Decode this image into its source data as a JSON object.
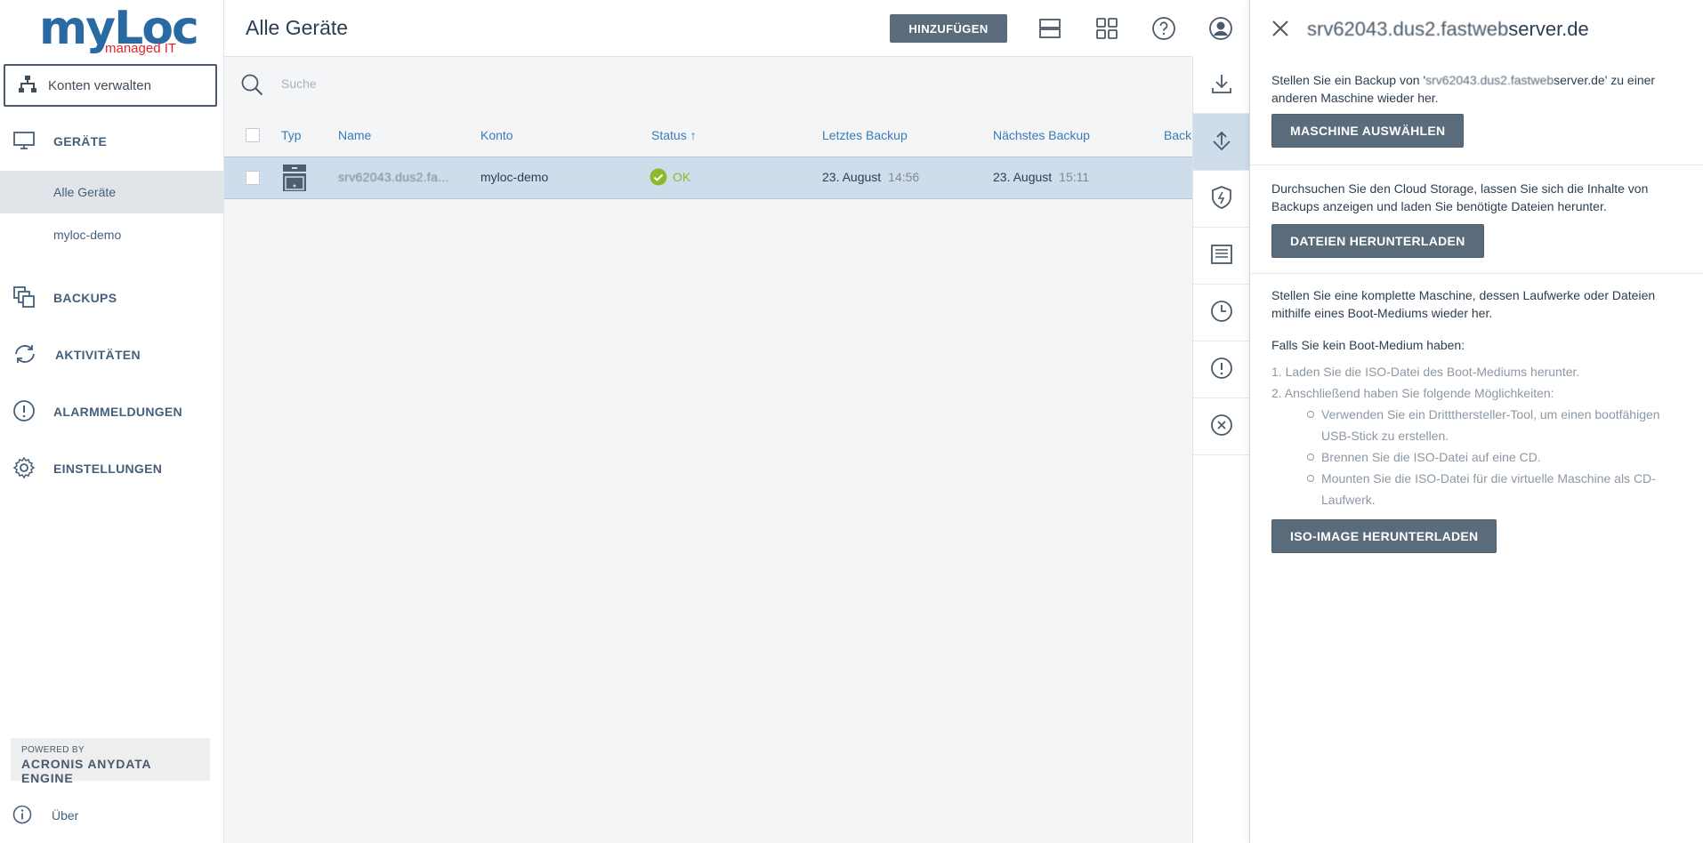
{
  "brand": {
    "name": "myLoc",
    "tagline": "managed IT",
    "primary": "#2a6aa3",
    "accent": "#e2232c"
  },
  "sidebar": {
    "konten_label": "Konten verwalten",
    "nav": [
      {
        "label": "GERÄTE",
        "icon": "monitor-icon"
      },
      {
        "label": "BACKUPS",
        "icon": "backups-icon"
      },
      {
        "label": "AKTIVITÄTEN",
        "icon": "sync-icon"
      },
      {
        "label": "ALARMMELDUNGEN",
        "icon": "alert-icon"
      },
      {
        "label": "EINSTELLUNGEN",
        "icon": "gear-icon"
      }
    ],
    "sub": [
      {
        "label": "Alle Geräte"
      },
      {
        "label": "myloc-demo"
      }
    ],
    "powered_by": "POWERED BY",
    "engine": "ACRONIS ANYDATA ENGINE",
    "about": "Über"
  },
  "header": {
    "title": "Alle Geräte",
    "add_label": "HINZUFÜGEN",
    "icons": [
      "list-view-icon",
      "grid-view-icon",
      "help-icon",
      "user-icon"
    ]
  },
  "search": {
    "placeholder": "Suche"
  },
  "table": {
    "columns": [
      "Typ",
      "Name",
      "Konto",
      "Status",
      "Letztes Backup",
      "Nächstes Backup",
      "Back"
    ],
    "sort_indicator": "↑",
    "rows": [
      {
        "name": "srv62043.dus2.fa...",
        "konto": "myloc-demo",
        "status": "OK",
        "last_date": "23. August",
        "last_time": "14:56",
        "next_date": "23. August",
        "next_time": "15:11"
      }
    ]
  },
  "strip": {
    "icons": [
      "download-icon",
      "recover-icon",
      "protect-icon",
      "details-icon",
      "history-icon",
      "alert-icon",
      "delete-icon"
    ]
  },
  "panel": {
    "title_blur": "srv62043.dus2.fastweb",
    "title_tail": "server.de",
    "s1_prefix": "Stellen Sie ein Backup von '",
    "s1_blur": "srv62043.dus2.fastweb",
    "s1_suffix": "server.de' zu einer anderen Maschine wieder her.",
    "s1_button": "MASCHINE AUSWÄHLEN",
    "s2_text": "Durchsuchen Sie den Cloud Storage, lassen Sie sich die Inhalte von Backups anzeigen und laden Sie benötigte Dateien herunter.",
    "s2_button": "DATEIEN HERUNTERLADEN",
    "s3_text": "Stellen Sie eine komplette Maschine, dessen Laufwerke oder Dateien mithilfe eines Boot-Mediums wieder her.",
    "s3_sub": "Falls Sie kein Boot-Medium haben:",
    "steps": [
      "1. Laden Sie die ISO-Datei des Boot-Mediums herunter.",
      "2. Anschließend haben Sie folgende Möglichkeiten:"
    ],
    "options": [
      "Verwenden Sie ein Drittthersteller-Tool, um einen bootfähigen USB-Stick zu erstellen.",
      "Brennen Sie die ISO-Datei auf eine CD.",
      "Mounten Sie die ISO-Datei für die virtuelle Maschine als CD-Laufwerk."
    ],
    "s3_button": "ISO-IMAGE HERUNTERLADEN"
  }
}
